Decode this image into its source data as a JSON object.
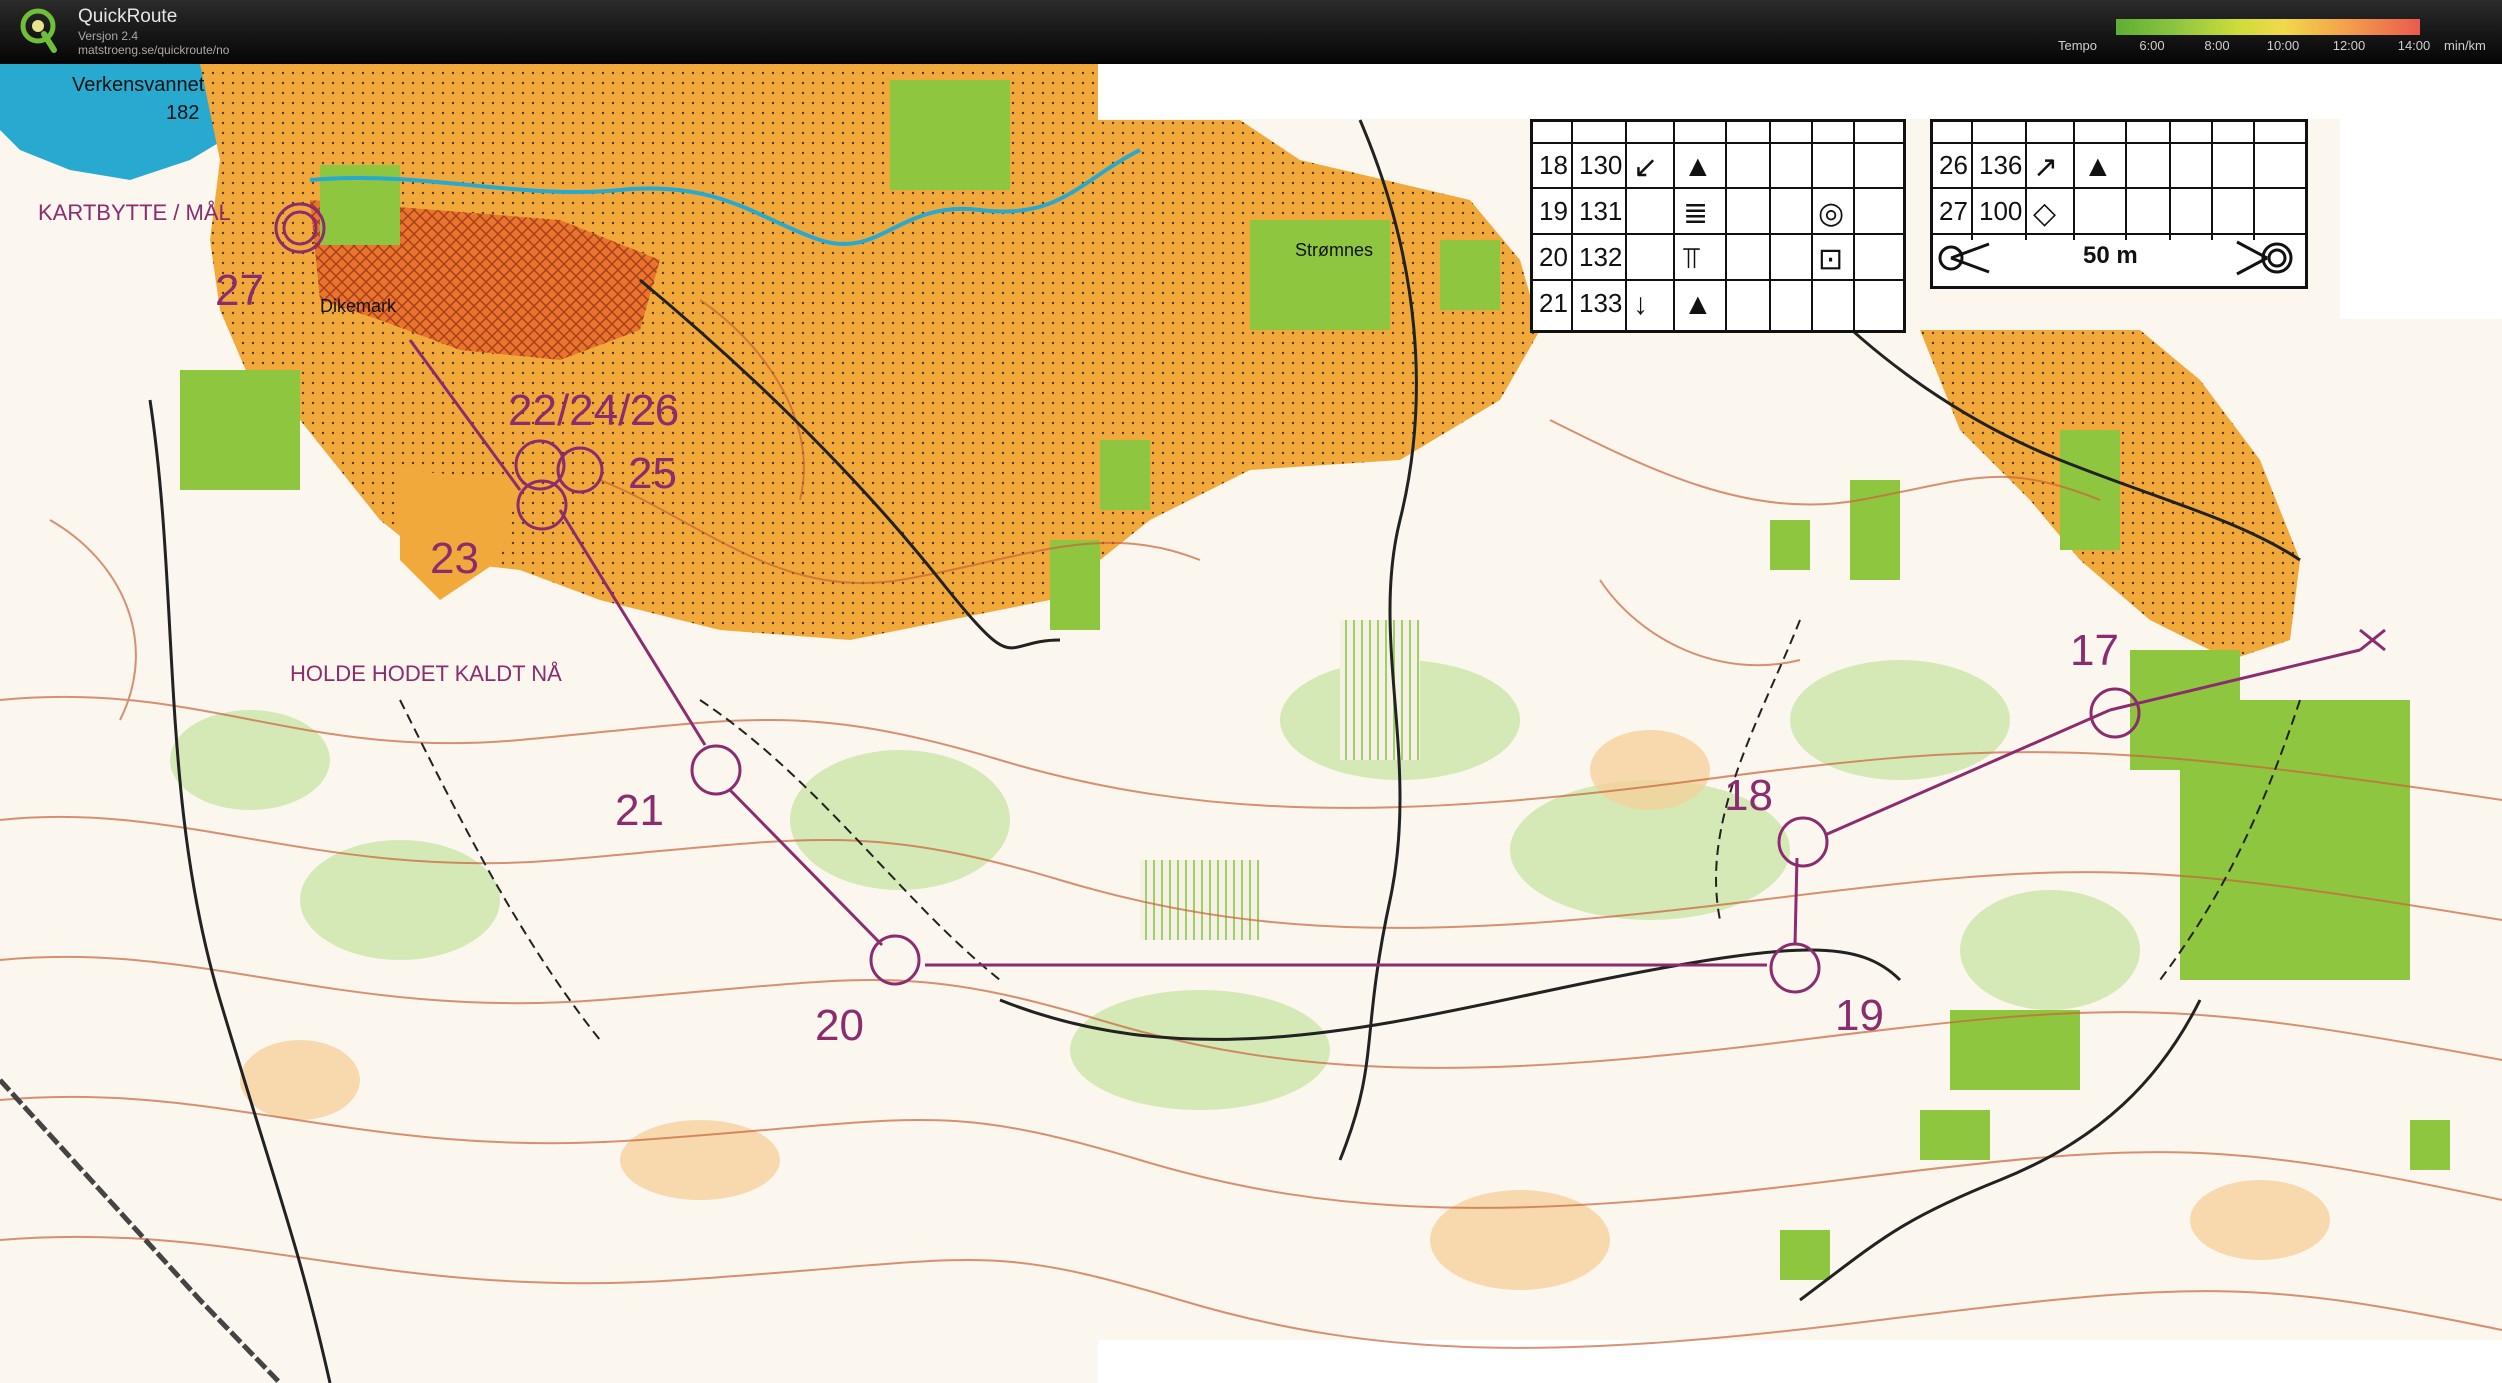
{
  "app": {
    "title": "QuickRoute",
    "version": "Versjon 2.4",
    "url": "matstroeng.se/quickroute/no"
  },
  "tempo_legend": {
    "label": "Tempo",
    "ticks": [
      "6:00",
      "8:00",
      "10:00",
      "12:00",
      "14:00"
    ],
    "unit": "min/km"
  },
  "map_labels": {
    "lake_name": "Verkensvannet",
    "lake_height": "182",
    "map_exchange": "KARTBYTTE / MÅL",
    "village": "Dikemark",
    "farm": "Strømnes",
    "warning": "HOLDE HODET KALDT NÅ"
  },
  "controls": [
    {
      "label": "17"
    },
    {
      "label": "18"
    },
    {
      "label": "19"
    },
    {
      "label": "20"
    },
    {
      "label": "21"
    },
    {
      "label": "22/24/26"
    },
    {
      "label": "23"
    },
    {
      "label": "25"
    },
    {
      "label": "27"
    }
  ],
  "control_descriptions_left": [
    {
      "num": "18",
      "code": "130",
      "sym1": "↙",
      "sym2": "▲",
      "sym3": ""
    },
    {
      "num": "19",
      "code": "131",
      "sym1": "≣",
      "sym2": "",
      "sym3": "◎"
    },
    {
      "num": "20",
      "code": "132",
      "sym1": "⫪",
      "sym2": "",
      "sym3": "⊡"
    },
    {
      "num": "21",
      "code": "133",
      "sym1": "↓",
      "sym2": "▲",
      "sym3": ""
    }
  ],
  "control_descriptions_right": [
    {
      "num": "26",
      "code": "136",
      "sym1": "↗",
      "sym2": "▲"
    },
    {
      "num": "27",
      "code": "100",
      "sym1": "◇",
      "sym2": ""
    }
  ],
  "finish_row": {
    "distance": "50 m"
  },
  "colors": {
    "course": "#8a2c6e",
    "open_land": "#f2a93b",
    "forest_green": "#8fc63f",
    "water": "#27a9d0",
    "contour": "#c8643a"
  }
}
